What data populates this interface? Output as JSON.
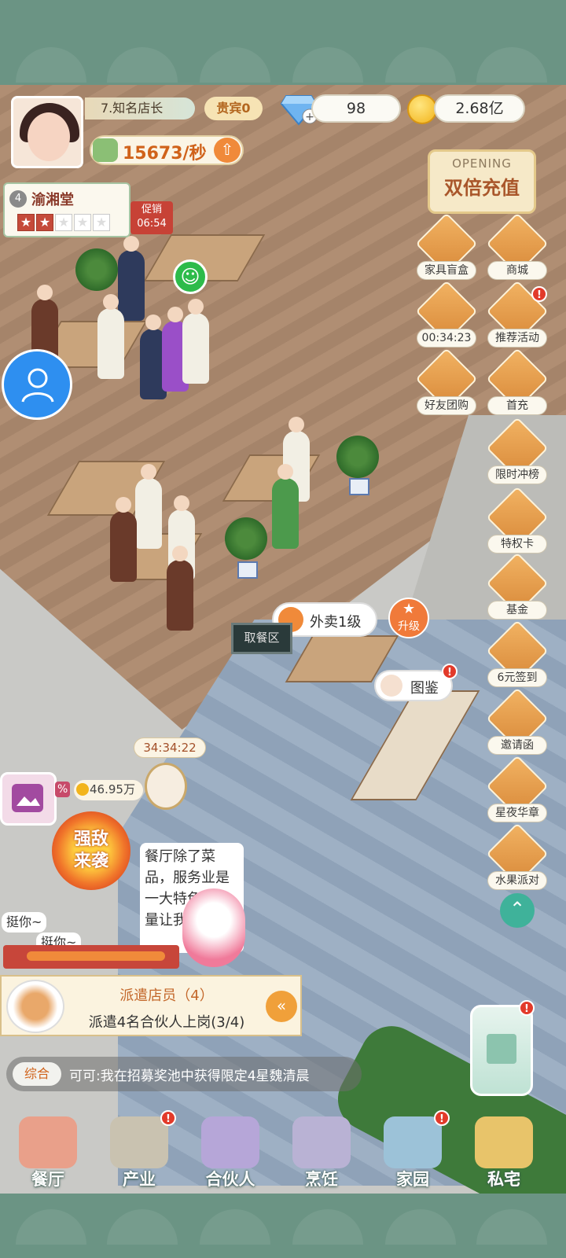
{
  "header": {
    "level_title": "7.知名店长",
    "vip_label": "贵宾0",
    "gems": "98",
    "gold": "2.68亿",
    "income": "15673/秒"
  },
  "shop": {
    "level": "4",
    "name": "渝湘堂",
    "stars_filled": 2,
    "stars_total": 5,
    "promo_label": "促销",
    "promo_timer": "06:54"
  },
  "side_menu": {
    "opening_small": "OPENING",
    "opening_big": "双倍充值",
    "items": [
      {
        "label": "家具盲盒",
        "icon": "gift-box-icon"
      },
      {
        "label": "商城",
        "icon": "shop-icon"
      },
      {
        "label": "00:34:23",
        "icon": "dumpling-icon"
      },
      {
        "label": "推荐活动",
        "icon": "gramophone-icon",
        "badge": "!"
      },
      {
        "label": "好友团购",
        "icon": "coupon-icon"
      },
      {
        "label": "首充",
        "icon": "gift-icon"
      },
      {
        "label": "限时冲榜",
        "icon": "pavilion-icon"
      },
      {
        "label": "特权卡",
        "icon": "card-icon"
      },
      {
        "label": "基金",
        "icon": "money-bag-icon"
      },
      {
        "label": "6元签到",
        "icon": "calendar-icon"
      },
      {
        "label": "邀请函",
        "icon": "invitation-icon"
      },
      {
        "label": "星夜华章",
        "icon": "gramophone-icon"
      },
      {
        "label": "水果派对",
        "icon": "fruit-icon"
      }
    ]
  },
  "scene": {
    "takeout_label": "外卖1级",
    "upgrade_label": "升级",
    "pickup_sign": "取餐区",
    "collection_label": "图鉴",
    "event_timer": "34:34:22",
    "event_coin": "46.95万",
    "percent_fragment": "%",
    "enemy_line1": "强敌",
    "enemy_line2": "来袭",
    "speech_text": "餐厅除了菜品，服务业是一大特色，胆量让我番吗？",
    "mini_bubble_1": "挺你~",
    "mini_bubble_2": "挺你~"
  },
  "task": {
    "title": "派遣店员（4）",
    "desc": "派遣4名合伙人上岗(3/4)"
  },
  "chat": {
    "tag": "综合",
    "message": "可可:我在招募奖池中获得限定4星魏清晨"
  },
  "nav": [
    {
      "label": "餐厅",
      "icon": "cash-register-icon",
      "color": "#e9a08a",
      "badge": ""
    },
    {
      "label": "产业",
      "icon": "map-board-icon",
      "color": "#c9c2b0",
      "badge": "!"
    },
    {
      "label": "合伙人",
      "icon": "portrait-icon",
      "color": "#b6a6d8",
      "badge": ""
    },
    {
      "label": "烹饪",
      "icon": "cooking-pot-icon",
      "color": "#b9b2d4",
      "badge": ""
    },
    {
      "label": "家园",
      "icon": "map-icon",
      "color": "#9cc2d8",
      "badge": "!"
    },
    {
      "label": "私宅",
      "icon": "keys-icon",
      "color": "#e8c46a",
      "badge": ""
    }
  ]
}
